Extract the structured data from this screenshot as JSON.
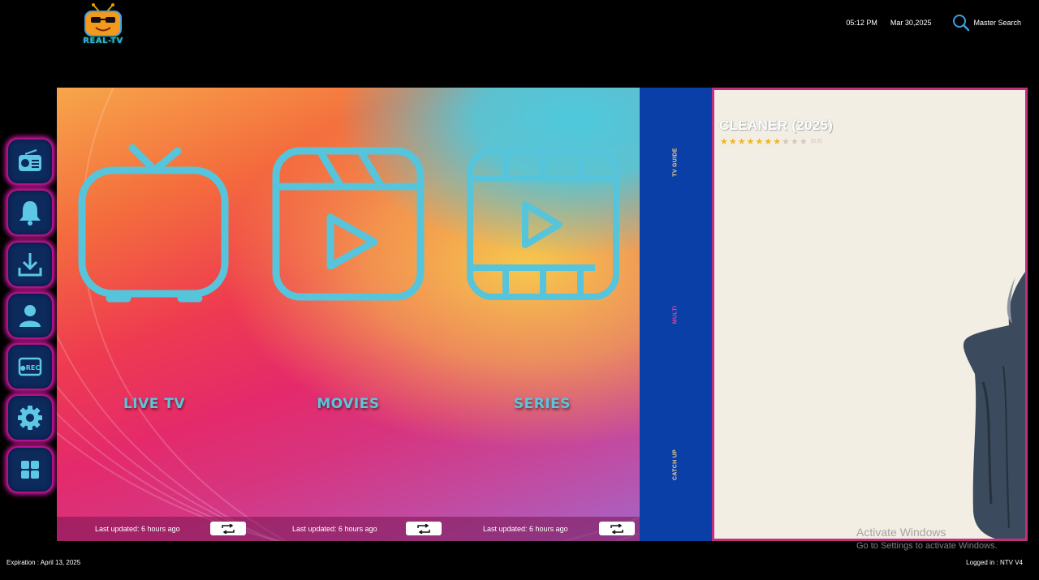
{
  "header": {
    "logo_text": "REAL-TV",
    "time": "05:12 PM",
    "date": "Mar 30,2025",
    "search_label": "Master Search",
    "search_icon": "search-icon"
  },
  "sidebar": {
    "items": [
      {
        "name": "radio",
        "icon": "radio-icon"
      },
      {
        "name": "notifications",
        "icon": "bell-icon"
      },
      {
        "name": "downloads",
        "icon": "download-icon"
      },
      {
        "name": "account",
        "icon": "user-icon"
      },
      {
        "name": "recordings",
        "icon": "rec-icon"
      },
      {
        "name": "settings",
        "icon": "gear-icon"
      },
      {
        "name": "more",
        "icon": "grid-icon"
      }
    ]
  },
  "main": {
    "tiles": [
      {
        "label": "LIVE TV",
        "icon": "tv-icon",
        "updated": "Last updated: 6 hours ago"
      },
      {
        "label": "MOVIES",
        "icon": "clapperboard-play-icon",
        "updated": "Last updated: 6 hours ago"
      },
      {
        "label": "SERIES",
        "icon": "film-play-icon",
        "updated": "Last updated: 6 hours ago"
      }
    ],
    "refresh_icon": "refresh-icon"
  },
  "side_menu": {
    "items": [
      {
        "label": "TV GUIDE",
        "color": "#f5d08a"
      },
      {
        "label": "MULTI",
        "color": "#e5449a"
      },
      {
        "label": "CATCH UP",
        "color": "#f5d08a"
      }
    ]
  },
  "featured": {
    "title": "CLEANER (2025)",
    "stars_filled": 7,
    "stars_total": 10,
    "rating_text": "(6.6)"
  },
  "watermark": {
    "line1": "Activate Windows",
    "line2": "Go to Settings to activate Windows."
  },
  "footer": {
    "expiration": "Expiration : April 13, 2025",
    "logged_in": "Logged in :  NTV V4"
  },
  "colors": {
    "accent": "#58c6dc",
    "sidebar_border": "#c0168f",
    "blue_column": "#0a3fa8"
  }
}
